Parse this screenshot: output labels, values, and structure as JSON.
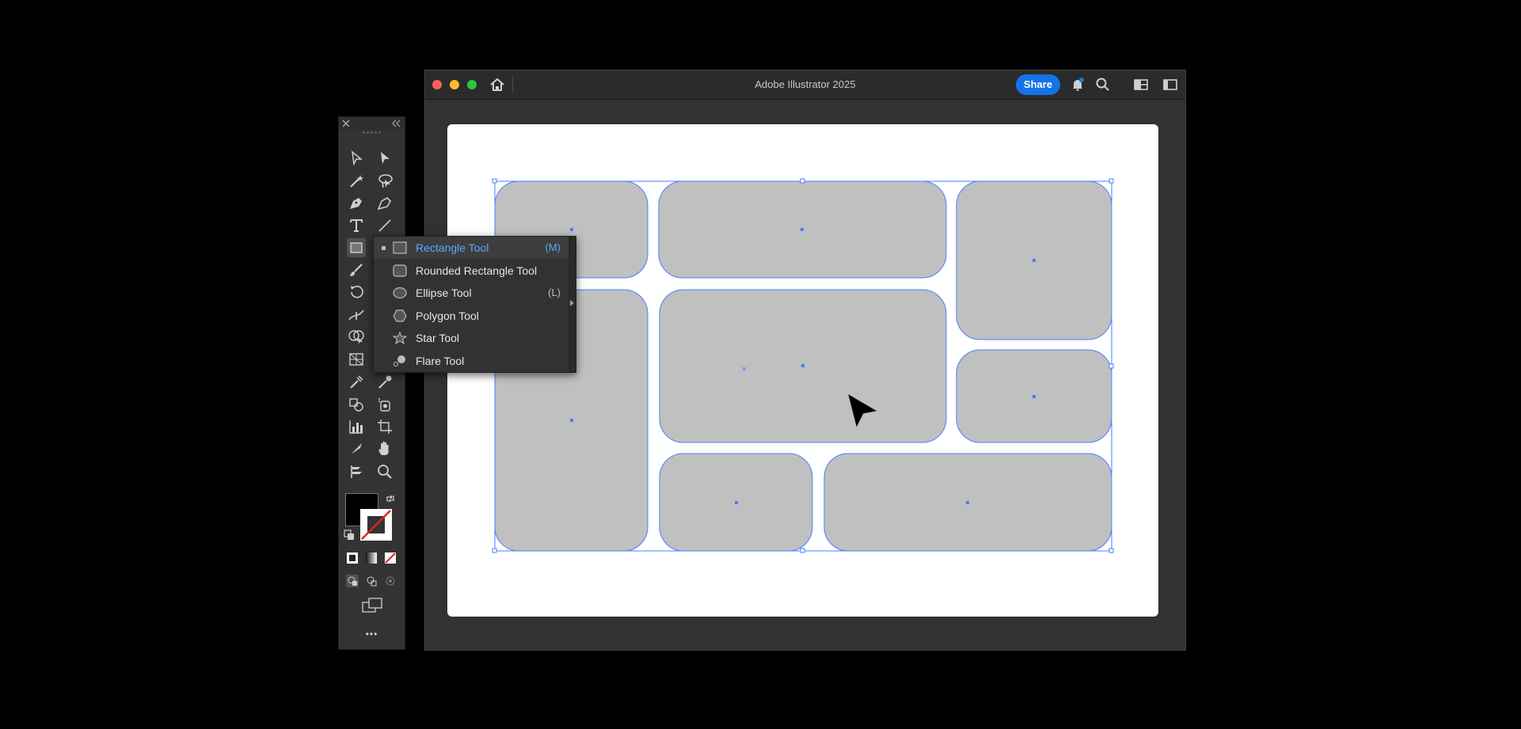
{
  "window": {
    "title": "Adobe Illustrator 2025",
    "share_label": "Share"
  },
  "flyout": {
    "items": [
      {
        "label": "Rectangle Tool",
        "shortcut": "(M)",
        "icon": "rectangle-icon",
        "selected": true
      },
      {
        "label": "Rounded Rectangle Tool",
        "shortcut": "",
        "icon": "rounded-rectangle-icon",
        "selected": false
      },
      {
        "label": "Ellipse Tool",
        "shortcut": "(L)",
        "icon": "ellipse-icon",
        "selected": false
      },
      {
        "label": "Polygon Tool",
        "shortcut": "",
        "icon": "polygon-icon",
        "selected": false
      },
      {
        "label": "Star Tool",
        "shortcut": "",
        "icon": "star-icon",
        "selected": false
      },
      {
        "label": "Flare Tool",
        "shortcut": "",
        "icon": "flare-icon",
        "selected": false
      }
    ]
  },
  "colors": {
    "accent": "#1473e6",
    "selection": "#4a7dff",
    "shape_fill": "#c0c0c0",
    "fill_color": "#000000",
    "stroke_color": "#ffffff"
  },
  "toolbar": {
    "more_label": "•••"
  }
}
